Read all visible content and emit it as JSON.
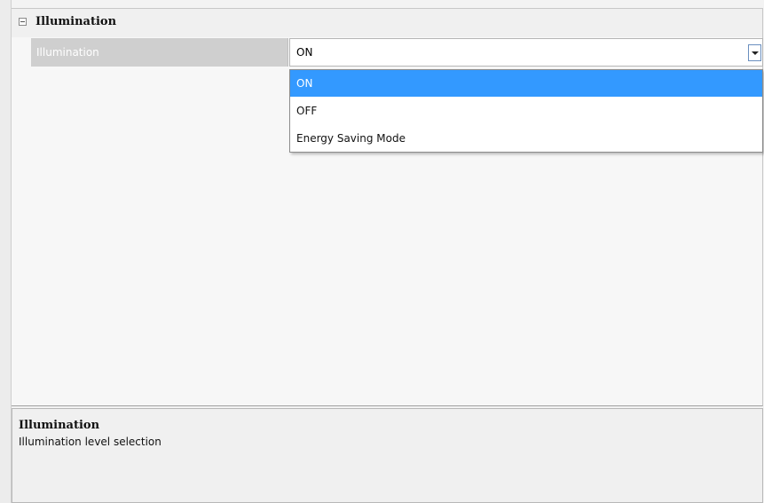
{
  "property_grid": {
    "category": {
      "label": "Illumination",
      "expander_icon": "collapse-minus-icon"
    },
    "property": {
      "name": "Illumination",
      "value": "ON"
    },
    "dropdown": {
      "is_open": true,
      "selected_index": 0,
      "options": [
        "ON",
        "OFF",
        "Energy Saving Mode"
      ],
      "highlight_color": "#3399ff"
    }
  },
  "description": {
    "title": "Illumination",
    "text": "Illumination level selection"
  }
}
